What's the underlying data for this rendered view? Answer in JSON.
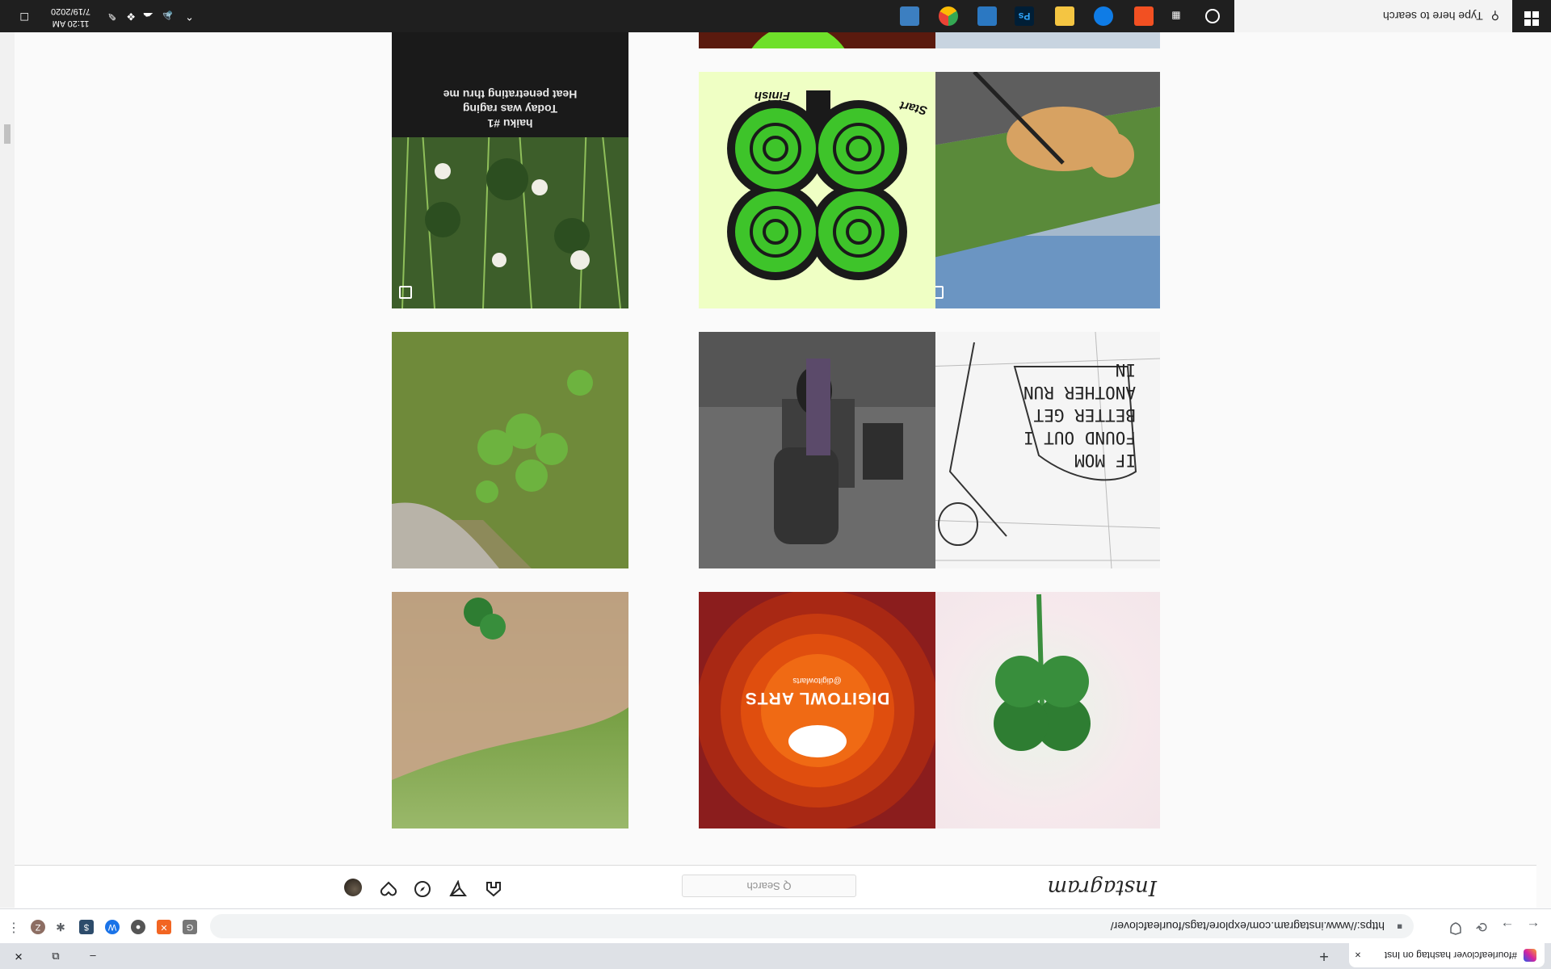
{
  "browser": {
    "tab_title": "#fourleafclover hashtag on Inst",
    "tab_close": "×",
    "new_tab": "+",
    "minimize": "–",
    "restore": "⧉",
    "close": "✕",
    "back": "←",
    "forward": "→",
    "reload": "⟳",
    "url": "https://www.instagram.com/explore/tags/fourleafclover/",
    "extensions": [
      "G",
      "✕",
      "●",
      "W",
      "$",
      "✱",
      "Z"
    ],
    "menu": "⋮"
  },
  "instagram": {
    "logo": "Instagram",
    "search_placeholder": "Q Search"
  },
  "posts": [
    {
      "caption": "haiku #1\nToday was raging\nHeat penetrating thru me"
    },
    {
      "caption": ""
    },
    {
      "caption": ""
    },
    {
      "caption": ""
    },
    {
      "caption_start": "Start",
      "caption_finish": "Finish"
    },
    {
      "caption": ""
    },
    {
      "caption": ""
    },
    {
      "caption": ""
    },
    {
      "caption": "IF MOM FOUND OUT I BETTER GET ANOTHER RUN IN"
    },
    {
      "caption": ""
    },
    {
      "caption": ""
    },
    {
      "caption": "DIGITOWL ARTS",
      "sub": "@digitowlarts"
    }
  ],
  "taskbar": {
    "search_placeholder": "Type here to search",
    "time": "11:20 AM",
    "date": "7/19/2020"
  }
}
